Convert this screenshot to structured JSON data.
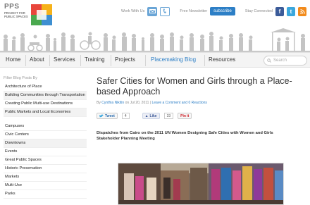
{
  "header": {
    "logo": {
      "title": "PPS",
      "subtitle": "PROJECT FOR PUBLIC SPACES"
    },
    "work_with_us": "Work With Us",
    "newsletter": "Free Newsletter",
    "subscribe": "subscribe",
    "stay_connected": "Stay Connected",
    "colors": {
      "accent": "#2d7fc6",
      "logo": [
        "#e8463c",
        "#f6b21a",
        "#4aa94f",
        "#3e8fd1"
      ]
    }
  },
  "nav": {
    "items": [
      "Home",
      "About",
      "Services",
      "Training",
      "Projects",
      "Placemaking Blog",
      "Resources"
    ],
    "active": "Placemaking Blog",
    "search_placeholder": "Search"
  },
  "sidebar": {
    "heading": "Filter Blog Posts By",
    "group1": [
      "Architecture of Place",
      "Building Communities through Transportation",
      "Creating Public Multi-use Destinations",
      "Public Markets and Local Economies"
    ],
    "group2": [
      "Campuses",
      "Civic Centers",
      "Downtowns",
      "Events",
      "Great Public Spaces",
      "Historic Preservation",
      "Markets",
      "Multi-Use",
      "Parks"
    ]
  },
  "post": {
    "title": "Safer Cities for Women and Girls through a Place-based Approach",
    "by": "By",
    "author": "Cynthia Nikitin",
    "on": "on Jul 20, 2011 |",
    "comments": "Leave a Comment and 0 Reactions",
    "tweet": "Tweet",
    "tweet_count": "4",
    "like": "Like",
    "like_count": "33",
    "pin": "Pin it",
    "intro": "Dispatches from Cairo on the 2011 UN Women Designing Safe Cities with Women and Girls Stakeholder Planning Meeting"
  }
}
